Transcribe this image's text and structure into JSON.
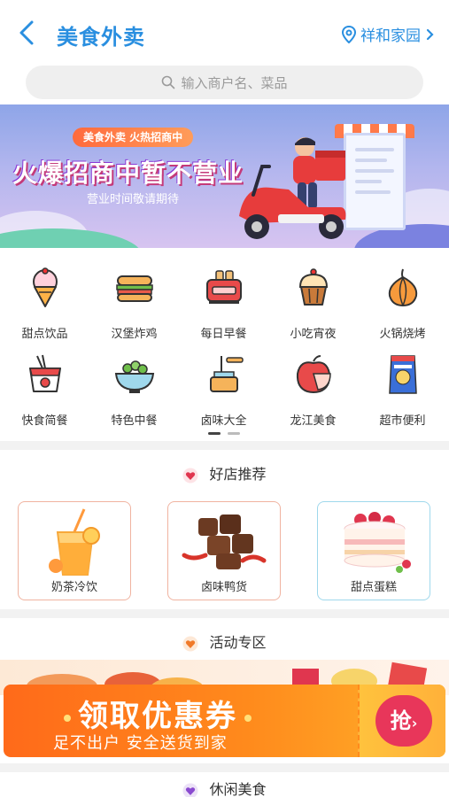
{
  "header": {
    "title": "美食外卖",
    "location": "祥和家园"
  },
  "search": {
    "placeholder": "输入商户名、菜品"
  },
  "banner": {
    "pill": "美食外卖 火热招商中",
    "headline": "火爆招商中暂不营业",
    "subline": "营业时间敬请期待"
  },
  "categories": [
    {
      "label": "甜点饮品",
      "icon": "ice-cream-icon"
    },
    {
      "label": "汉堡炸鸡",
      "icon": "sandwich-icon"
    },
    {
      "label": "每日早餐",
      "icon": "toaster-icon"
    },
    {
      "label": "小吃宵夜",
      "icon": "muffin-icon"
    },
    {
      "label": "火锅烧烤",
      "icon": "onion-icon"
    },
    {
      "label": "快食简餐",
      "icon": "noodle-box-icon"
    },
    {
      "label": "特色中餐",
      "icon": "salad-bowl-icon"
    },
    {
      "label": "卤味大全",
      "icon": "honey-jar-icon"
    },
    {
      "label": "龙江美食",
      "icon": "apple-icon"
    },
    {
      "label": "超市便利",
      "icon": "snack-bag-icon"
    }
  ],
  "pager": {
    "current": 1,
    "total": 2
  },
  "recommend": {
    "title": "好店推荐",
    "cards": [
      {
        "label": "奶茶冷饮"
      },
      {
        "label": "卤味鸭货"
      },
      {
        "label": "甜点蛋糕"
      }
    ]
  },
  "activity": {
    "title": "活动专区",
    "coupon_title": "领取优惠券",
    "coupon_sub": "足不出户 安全送货到家",
    "coupon_button": "抢"
  },
  "leisure": {
    "title": "休闲美食"
  },
  "colors": {
    "accent": "#2a8fe0",
    "coupon": "#ff8a1c",
    "heart": "#e0364f"
  }
}
